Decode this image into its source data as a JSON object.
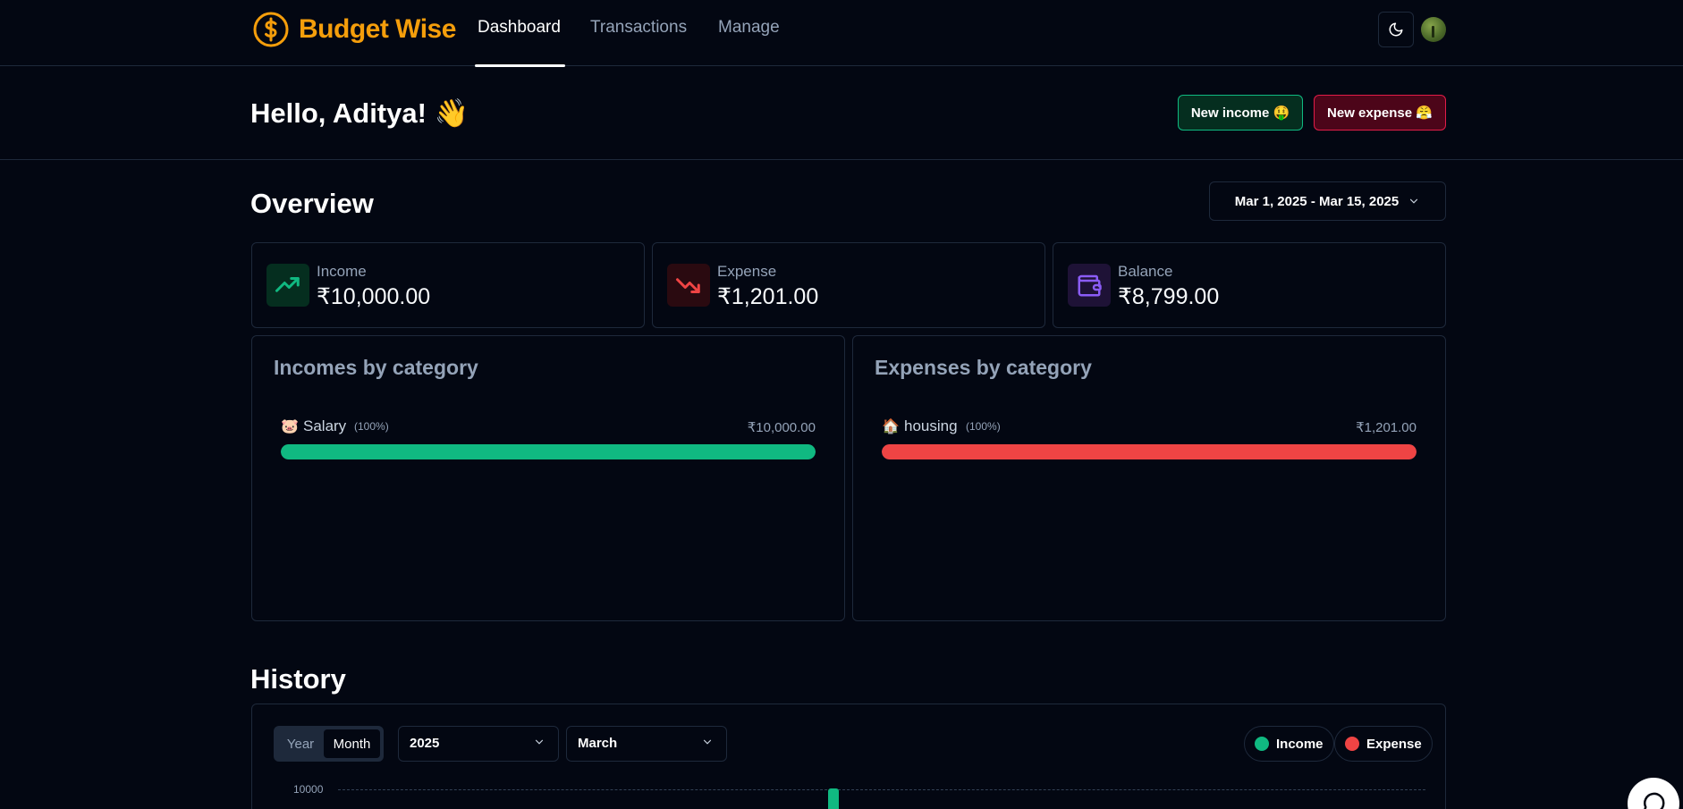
{
  "brand": {
    "name": "Budget Wise",
    "accent": "#f59e0b"
  },
  "nav": {
    "items": [
      {
        "label": "Dashboard",
        "active": true
      },
      {
        "label": "Transactions",
        "active": false
      },
      {
        "label": "Manage",
        "active": false
      }
    ]
  },
  "header": {
    "greeting": "Hello, Aditya! 👋",
    "new_income_label": "New income 🤑",
    "new_expense_label": "New expense 😤"
  },
  "overview": {
    "title": "Overview",
    "date_range": "Mar 1, 2025 - Mar 15, 2025",
    "stats": [
      {
        "label": "Income",
        "value": "₹10,000.00",
        "icon": "trending-up-icon",
        "color": "#10b981"
      },
      {
        "label": "Expense",
        "value": "₹1,201.00",
        "icon": "trending-down-icon",
        "color": "#ef4444"
      },
      {
        "label": "Balance",
        "value": "₹8,799.00",
        "icon": "wallet-icon",
        "color": "#8b5cf6"
      }
    ],
    "incomes_by_category": {
      "title": "Incomes by category",
      "items": [
        {
          "emoji": "🐷",
          "name": "Salary",
          "percent_label": "(100%)",
          "amount": "₹10,000.00",
          "percent": 100,
          "color": "#10b981"
        }
      ]
    },
    "expenses_by_category": {
      "title": "Expenses by category",
      "items": [
        {
          "emoji": "🏠",
          "name": "housing",
          "percent_label": "(100%)",
          "amount": "₹1,201.00",
          "percent": 100,
          "color": "#ef4444"
        }
      ]
    }
  },
  "history": {
    "title": "History",
    "period_toggle": {
      "options": [
        "Year",
        "Month"
      ],
      "selected": "Month"
    },
    "year_select": "2025",
    "month_select": "March",
    "legend": [
      {
        "label": "Income",
        "color": "#10b981"
      },
      {
        "label": "Expense",
        "color": "#ef4444"
      }
    ],
    "y_tick_top": "10000"
  }
}
